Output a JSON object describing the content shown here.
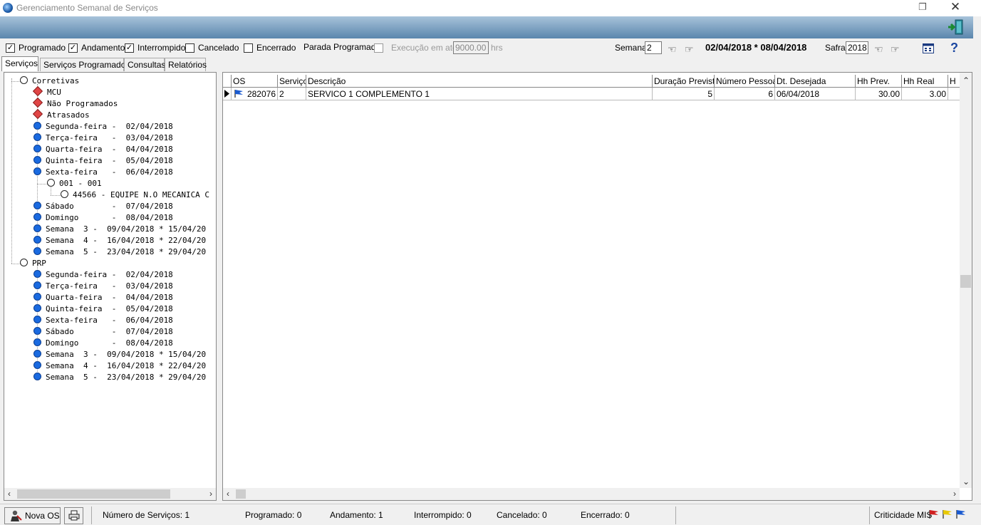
{
  "window": {
    "title": "Gerenciamento Semanal de Serviços",
    "restore": "❐",
    "close": "✕"
  },
  "filters": {
    "programado": {
      "label": "Programado",
      "checked": true
    },
    "andamento": {
      "label": "Andamento",
      "checked": true
    },
    "interrompido": {
      "label": "Interrompido",
      "checked": true
    },
    "cancelado": {
      "label": "Cancelado",
      "checked": false
    },
    "encerrado": {
      "label": "Encerrado",
      "checked": false
    },
    "parada": {
      "label": "Parada Programada",
      "checked": false
    },
    "execucao_label": "Execução em até",
    "execucao_value": "9000.00",
    "execucao_unit": "hrs"
  },
  "semana": {
    "label": "Semana",
    "value": "2",
    "range": "02/04/2018 * 08/04/2018"
  },
  "safra": {
    "label": "Safra",
    "value": "2018"
  },
  "tabs": [
    "Serviços",
    "Serviços Programados",
    "Consultas",
    "Relatórios"
  ],
  "tree": [
    {
      "icon": "open",
      "level": 0,
      "text": "Corretivas"
    },
    {
      "icon": "diamond",
      "level": 1,
      "text": "MCU"
    },
    {
      "icon": "diamond",
      "level": 1,
      "text": "Não Programados"
    },
    {
      "icon": "diamond",
      "level": 1,
      "text": "Atrasados"
    },
    {
      "icon": "blue",
      "level": 1,
      "text": "Segunda-feira -  02/04/2018"
    },
    {
      "icon": "blue",
      "level": 1,
      "text": "Terça-feira   -  03/04/2018"
    },
    {
      "icon": "blue",
      "level": 1,
      "text": "Quarta-feira  -  04/04/2018"
    },
    {
      "icon": "blue",
      "level": 1,
      "text": "Quinta-feira  -  05/04/2018"
    },
    {
      "icon": "blue",
      "level": 1,
      "text": "Sexta-feira   -  06/04/2018"
    },
    {
      "icon": "open",
      "level": 2,
      "text": "001 - 001"
    },
    {
      "icon": "open",
      "level": 3,
      "text": "44566 - EQUIPE N.O MECANICA C"
    },
    {
      "icon": "blue",
      "level": 1,
      "text": "Sábado        -  07/04/2018"
    },
    {
      "icon": "blue",
      "level": 1,
      "text": "Domingo       -  08/04/2018"
    },
    {
      "icon": "blue",
      "level": 1,
      "text": "Semana  3 -  09/04/2018 * 15/04/20"
    },
    {
      "icon": "blue",
      "level": 1,
      "text": "Semana  4 -  16/04/2018 * 22/04/20"
    },
    {
      "icon": "blue",
      "level": 1,
      "text": "Semana  5 -  23/04/2018 * 29/04/20"
    },
    {
      "icon": "open",
      "level": 0,
      "text": "PRP"
    },
    {
      "icon": "blue",
      "level": 1,
      "text": "Segunda-feira -  02/04/2018"
    },
    {
      "icon": "blue",
      "level": 1,
      "text": "Terça-feira   -  03/04/2018"
    },
    {
      "icon": "blue",
      "level": 1,
      "text": "Quarta-feira  -  04/04/2018"
    },
    {
      "icon": "blue",
      "level": 1,
      "text": "Quinta-feira  -  05/04/2018"
    },
    {
      "icon": "blue",
      "level": 1,
      "text": "Sexta-feira   -  06/04/2018"
    },
    {
      "icon": "blue",
      "level": 1,
      "text": "Sábado        -  07/04/2018"
    },
    {
      "icon": "blue",
      "level": 1,
      "text": "Domingo       -  08/04/2018"
    },
    {
      "icon": "blue",
      "level": 1,
      "text": "Semana  3 -  09/04/2018 * 15/04/20"
    },
    {
      "icon": "blue",
      "level": 1,
      "text": "Semana  4 -  16/04/2018 * 22/04/20"
    },
    {
      "icon": "blue",
      "level": 1,
      "text": "Semana  5 -  23/04/2018 * 29/04/20"
    }
  ],
  "grid": {
    "columns": [
      "OS",
      "Serviço",
      "Descrição",
      "Duração Prevista",
      "Número Pessoas",
      "Dt. Desejada",
      "Hh Prev.",
      "Hh Real",
      "H"
    ],
    "rows": [
      {
        "os": "282076",
        "servico": "2",
        "descricao": "SERVICO 1 COMPLEMENTO 1",
        "duracao": "5",
        "pessoas": "6",
        "dt": "06/04/2018",
        "hh_prev": "30.00",
        "hh_real": "3.00"
      }
    ]
  },
  "status": {
    "nova_os": "Nova OS",
    "numero": "Número de Serviços: 1",
    "programado": "Programado: 0",
    "andamento": "Andamento: 1",
    "interrompido": "Interrompido: 0",
    "cancelado": "Cancelado: 0",
    "encerrado": "Encerrado: 0",
    "criticidade": "Criticidade MIS"
  },
  "colors": {
    "flag_red": "#d02020",
    "flag_yellow": "#e8c800",
    "flag_blue": "#1a5ad0"
  }
}
